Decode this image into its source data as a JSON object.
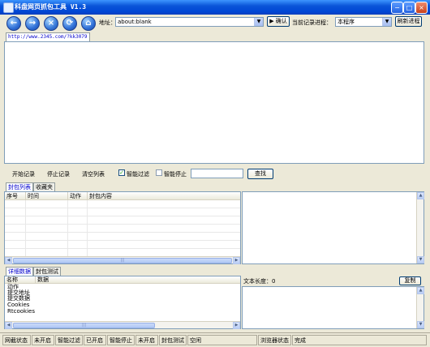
{
  "window": {
    "title": "科盘网页抓包工具 V1.3",
    "minimize": "−",
    "maximize": "□",
    "close": "×"
  },
  "toolbar": {
    "back_glyph": "←",
    "forward_glyph": "→",
    "stop_glyph": "×",
    "refresh_glyph": "⟳",
    "home_glyph": "⌂",
    "address_label": "地址：",
    "address_value": "about:blank",
    "confirm_label": "▶ 确认",
    "process_label": "当前记录进程：",
    "process_value": "本程序",
    "refresh_process_label": "刷新进程"
  },
  "browser_tab": {
    "label": "http://www.2345.com/?kk3079"
  },
  "controls": {
    "start_record": "开始记录",
    "stop_record": "停止记录",
    "clear_list": "清空列表",
    "smart_filter": "智能过滤",
    "smart_filter_checked": true,
    "smart_stop": "智能停止",
    "smart_stop_checked": false,
    "search_value": "",
    "search_button": "查找"
  },
  "packet_tabs": [
    "封包列表",
    "收藏夹"
  ],
  "packet_table": {
    "columns": [
      "序号",
      "时间",
      "动作",
      "封包内容"
    ]
  },
  "detail_tabs": [
    "详细数据",
    "封包测试"
  ],
  "detail_table": {
    "columns": [
      "名称",
      "数据"
    ],
    "rows": [
      "动作",
      "提交地址",
      "提交数据",
      "Cookies",
      "Rtcookies"
    ]
  },
  "text_panel": {
    "length_label": "文本长度：0",
    "copy_button": "复制"
  },
  "status_bar": {
    "items": [
      "网截状态",
      "未开启",
      "智能过滤",
      "已开启",
      "智能停止",
      "未开启",
      "封包测试",
      "空闲",
      "浏览器状态",
      "完成"
    ]
  },
  "scroll": {
    "thumb_grip": "|||"
  }
}
